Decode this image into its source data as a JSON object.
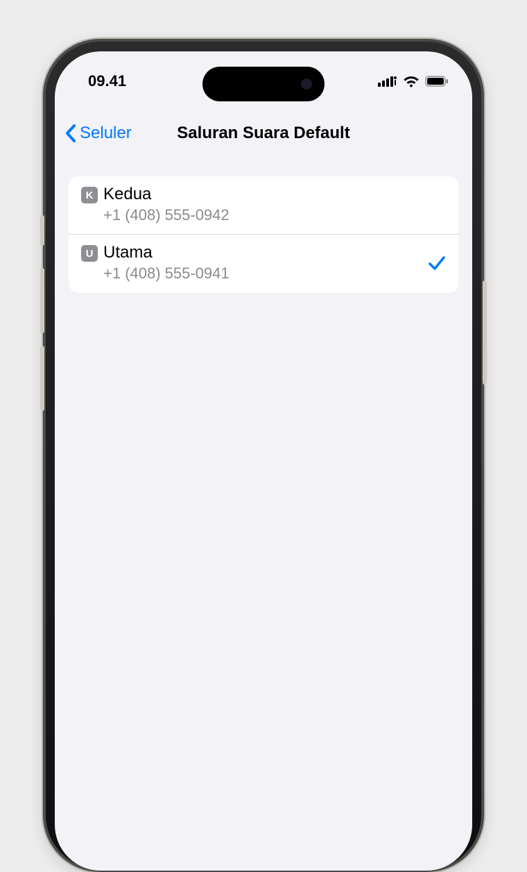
{
  "status": {
    "time": "09.41"
  },
  "nav": {
    "back_label": "Seluler",
    "title": "Saluran Suara Default"
  },
  "lines": [
    {
      "badge": "K",
      "name": "Kedua",
      "number": "+1 (408) 555-0942",
      "selected": false
    },
    {
      "badge": "U",
      "name": "Utama",
      "number": "+1 (408) 555-0941",
      "selected": true
    }
  ],
  "colors": {
    "accent": "#007aff",
    "background": "#f2f2f7",
    "badge": "#8e8e93"
  }
}
